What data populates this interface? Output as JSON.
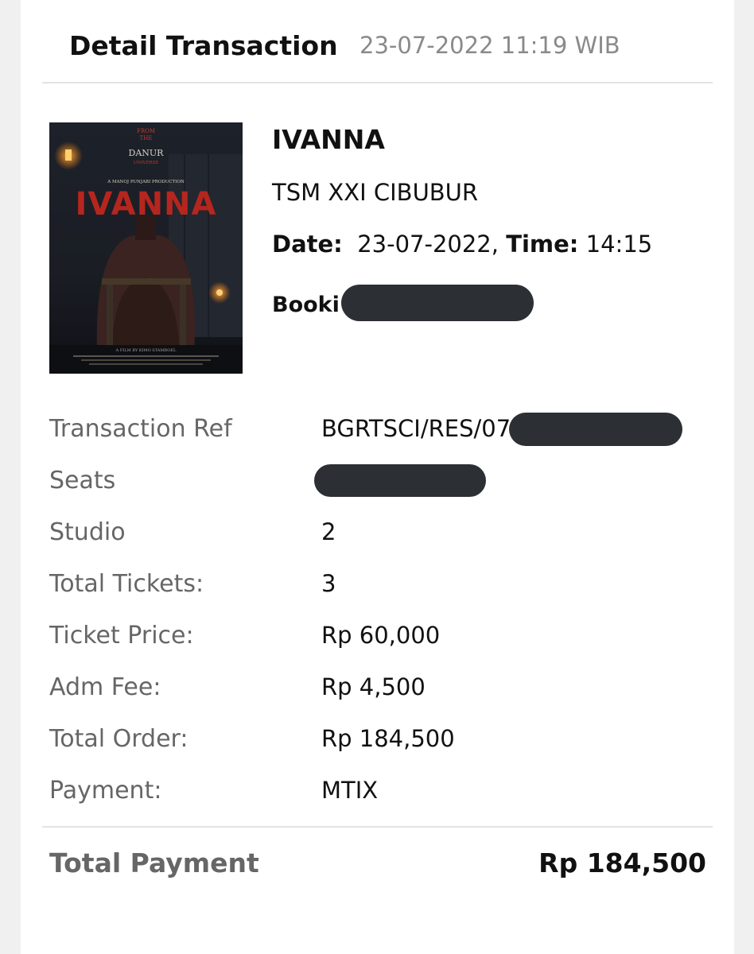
{
  "header": {
    "title": "Detail Transaction",
    "datetime": "23-07-2022 11:19 WIB"
  },
  "movie": {
    "title": "IVANNA",
    "cinema": "TSM XXI CIBUBUR",
    "date_label": "Date:",
    "date_value": "23-07-2022,",
    "time_label": "Time:",
    "time_value": "14:15",
    "booking_label": "Booki"
  },
  "poster": {
    "top_line1": "FROM",
    "top_line2": "THE",
    "top_line3": "DANUR",
    "top_line4": "UNIVERSE",
    "production": "A MANOJ PUNJABI PRODUCTION",
    "title": "IVANNA",
    "credit": "A FILM BY KIMO STAMBOEL"
  },
  "details": [
    {
      "label": "Transaction Ref",
      "value": "BGRTSCI/RES/07"
    },
    {
      "label": "Seats",
      "value": ""
    },
    {
      "label": "Studio",
      "value": "2"
    },
    {
      "label": "Total Tickets:",
      "value": "3"
    },
    {
      "label": "Ticket Price:",
      "value": "Rp 60,000"
    },
    {
      "label": "Adm Fee:",
      "value": "Rp 4,500"
    },
    {
      "label": "Total Order:",
      "value": "Rp 184,500"
    },
    {
      "label": "Payment:",
      "value": "MTIX"
    }
  ],
  "total": {
    "label": "Total Payment",
    "value": "Rp 184,500"
  },
  "colors": {
    "label_gray": "#666666",
    "redaction": "#2c2f34",
    "poster_title_red": "#b5261e"
  }
}
